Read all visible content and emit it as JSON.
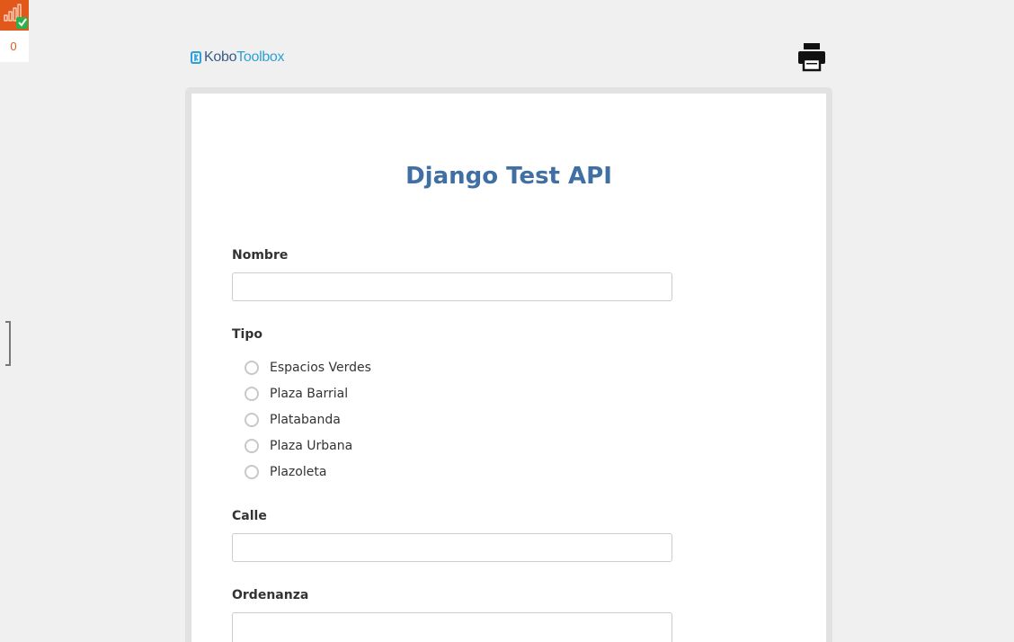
{
  "queue": {
    "count": "0",
    "icon": "bar-chart-check-icon"
  },
  "header": {
    "logo_kobo": "Kobo",
    "logo_toolbox": "Toolbox",
    "print_icon": "printer-icon"
  },
  "form": {
    "title": "Django Test API",
    "questions": {
      "nombre": {
        "label": "Nombre",
        "value": ""
      },
      "tipo": {
        "label": "Tipo",
        "options": [
          "Espacios Verdes",
          "Plaza Barrial",
          "Platabanda",
          "Plaza Urbana",
          "Plazoleta"
        ]
      },
      "calle": {
        "label": "Calle",
        "value": ""
      },
      "ordenanza": {
        "label": "Ordenanza",
        "value": ""
      }
    }
  },
  "colors": {
    "accent": "#3f6fa3",
    "queue_bg": "#e2581b",
    "check_green": "#2bb24c",
    "logo_blue": "#2ea0d8"
  }
}
